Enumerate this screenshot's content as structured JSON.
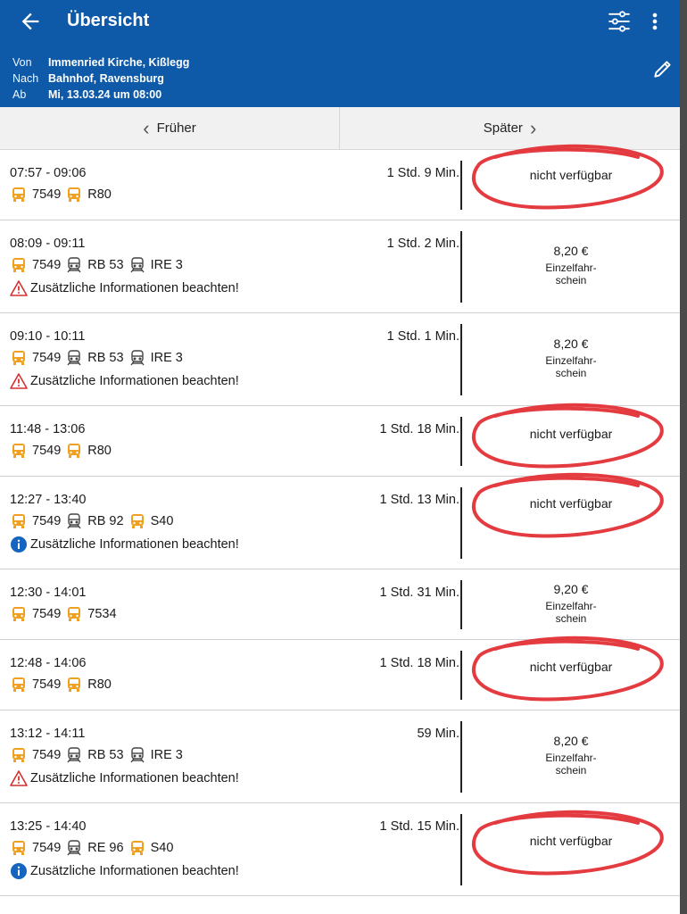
{
  "header": {
    "title": "Übersicht",
    "from_label": "Von",
    "from_value": "Immenried Kirche, Kißlegg",
    "to_label": "Nach",
    "to_value": "Bahnhof, Ravensburg",
    "dep_label": "Ab",
    "dep_value": "Mi, 13.03.24 um 08:00"
  },
  "pager": {
    "earlier": "Früher",
    "later": "Später"
  },
  "colors": {
    "header": "#0f5aa8",
    "bus": "#f0a020",
    "warning": "#d43030",
    "info": "#1565c0",
    "marker": "#e0262a"
  },
  "connections": [
    {
      "time": "07:57 - 09:06",
      "duration": "1 Std. 9 Min.",
      "lines": [
        [
          "bus",
          "7549"
        ],
        [
          "bus",
          "R80"
        ]
      ],
      "info": "",
      "price": "nicht verfügbar",
      "ticket": ""
    },
    {
      "time": "08:09 - 09:11",
      "duration": "1 Std. 2 Min.",
      "lines": [
        [
          "bus",
          "7549"
        ],
        [
          "train",
          "RB 53"
        ],
        [
          "train",
          "IRE 3"
        ]
      ],
      "info": "Zusätzliche Informationen beachten!",
      "info_icon": "warning-icon",
      "price": "8,20 €",
      "ticket": "Einzelfahr-\nschein"
    },
    {
      "time": "09:10 - 10:11",
      "duration": "1 Std. 1 Min.",
      "lines": [
        [
          "bus",
          "7549"
        ],
        [
          "train",
          "RB 53"
        ],
        [
          "train",
          "IRE 3"
        ]
      ],
      "info": "Zusätzliche Informationen beachten!",
      "info_icon": "warning-icon",
      "price": "8,20 €",
      "ticket": "Einzelfahr-\nschein"
    },
    {
      "time": "11:48 - 13:06",
      "duration": "1 Std. 18 Min.",
      "lines": [
        [
          "bus",
          "7549"
        ],
        [
          "bus",
          "R80"
        ]
      ],
      "info": "",
      "price": "nicht verfügbar",
      "ticket": ""
    },
    {
      "time": "12:27 - 13:40",
      "duration": "1 Std. 13 Min.",
      "lines": [
        [
          "bus",
          "7549"
        ],
        [
          "train",
          "RB 92"
        ],
        [
          "bus",
          "S40"
        ]
      ],
      "info": "Zusätzliche Informationen beachten!",
      "info_icon": "info-icon",
      "price": "nicht verfügbar",
      "ticket": ""
    },
    {
      "time": "12:30 - 14:01",
      "duration": "1 Std. 31 Min.",
      "lines": [
        [
          "bus",
          "7549"
        ],
        [
          "bus",
          "7534"
        ]
      ],
      "info": "",
      "price": "9,20 €",
      "ticket": "Einzelfahr-\nschein"
    },
    {
      "time": "12:48 - 14:06",
      "duration": "1 Std. 18 Min.",
      "lines": [
        [
          "bus",
          "7549"
        ],
        [
          "bus",
          "R80"
        ]
      ],
      "info": "",
      "price": "nicht verfügbar",
      "ticket": ""
    },
    {
      "time": "13:12 - 14:11",
      "duration": "59 Min.",
      "lines": [
        [
          "bus",
          "7549"
        ],
        [
          "train",
          "RB 53"
        ],
        [
          "train",
          "IRE 3"
        ]
      ],
      "info": "Zusätzliche Informationen beachten!",
      "info_icon": "warning-icon",
      "price": "8,20 €",
      "ticket": "Einzelfahr-\nschein"
    },
    {
      "time": "13:25 - 14:40",
      "duration": "1 Std. 15 Min.",
      "lines": [
        [
          "bus",
          "7549"
        ],
        [
          "train",
          "RE 96"
        ],
        [
          "bus",
          "S40"
        ]
      ],
      "info": "Zusätzliche Informationen beachten!",
      "info_icon": "info-icon",
      "price": "nicht verfügbar",
      "ticket": ""
    }
  ]
}
